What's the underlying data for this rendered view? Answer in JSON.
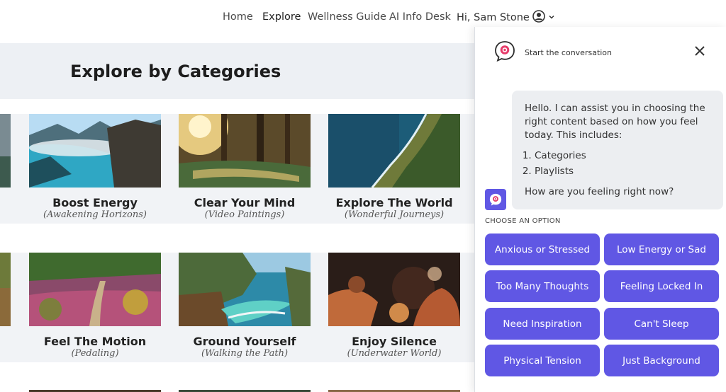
{
  "nav": {
    "items": [
      {
        "label": "Home",
        "active": false
      },
      {
        "label": "Explore",
        "active": true
      },
      {
        "label": "Wellness Guide",
        "active": false
      },
      {
        "label": "AI Info Desk",
        "active": false
      }
    ],
    "user_greeting": "Hi, Sam Stone",
    "user_icon": "user-circle-icon",
    "dropdown_icon": "chevron-down-icon"
  },
  "page": {
    "heading": "Explore by Categories"
  },
  "categories": [
    {
      "title": "Boost Energy",
      "subtitle": "(Awakening Horizons)",
      "image": "mountain-lake-clouds"
    },
    {
      "title": "Clear Your Mind",
      "subtitle": "(Video Paintings)",
      "image": "sunlit-forest-stream"
    },
    {
      "title": "Explore The World",
      "subtitle": "(Wonderful Journeys)",
      "image": "aerial-coastline"
    },
    {
      "title": "Feel The Motion",
      "subtitle": "(Pedaling)",
      "image": "autumn-trail"
    },
    {
      "title": "Ground Yourself",
      "subtitle": "(Walking the Path)",
      "image": "cove-waterfall"
    },
    {
      "title": "Enjoy Silence",
      "subtitle": "(Underwater World)",
      "image": "coral-reef"
    }
  ],
  "chat": {
    "header_label": "Start the conversation",
    "close_icon": "close-icon",
    "message_intro": "Hello. I can assist you in choosing the right content based on how you feel today. This includes:",
    "message_list": [
      "Categories",
      "Playlists"
    ],
    "message_question": "How are you feeling right now?",
    "choose_label": "CHOOSE AN OPTION",
    "options": [
      "Anxious or Stressed",
      "Low Energy or Sad",
      "Too Many Thoughts",
      "Feeling Locked In",
      "Need Inspiration",
      "Can't Sleep",
      "Physical Tension",
      "Just Background"
    ],
    "accent_color": "#6057e4"
  }
}
